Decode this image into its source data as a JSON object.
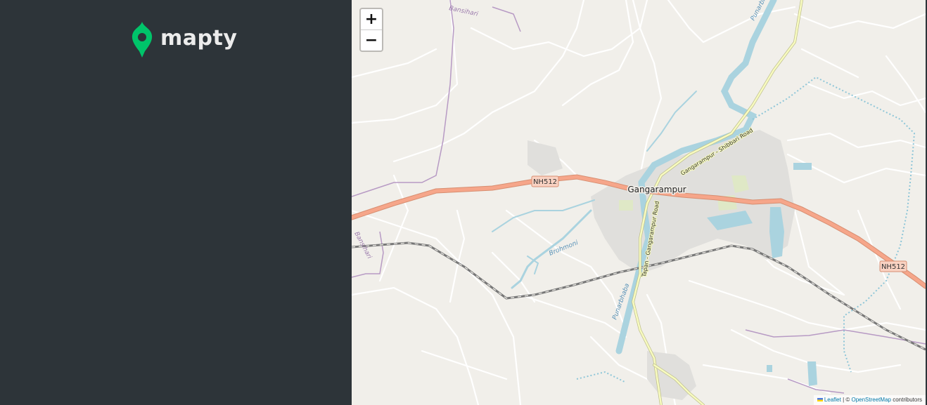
{
  "app": {
    "logo_text": "mapty",
    "logo_icon": "map-pin-icon",
    "accent": "#00c46a"
  },
  "map": {
    "zoom_in": "+",
    "zoom_out": "−",
    "attribution": {
      "leaflet": "Leaflet",
      "separator": " | © ",
      "osm": "OpenStreetMap",
      "suffix": " contributors"
    },
    "labels": {
      "town": "Gangarampur",
      "highway_1": "NH512",
      "highway_2": "NH512",
      "river_1": "Bansihari",
      "river_2": "Bansihari",
      "river_3": "Brohmoni",
      "river_4": "Punarbhaba",
      "river_5": "Punarbhaba",
      "road_1": "Gangarampur - Shibbari Road",
      "road_2": "Tapan - Gangarampur Road"
    }
  }
}
